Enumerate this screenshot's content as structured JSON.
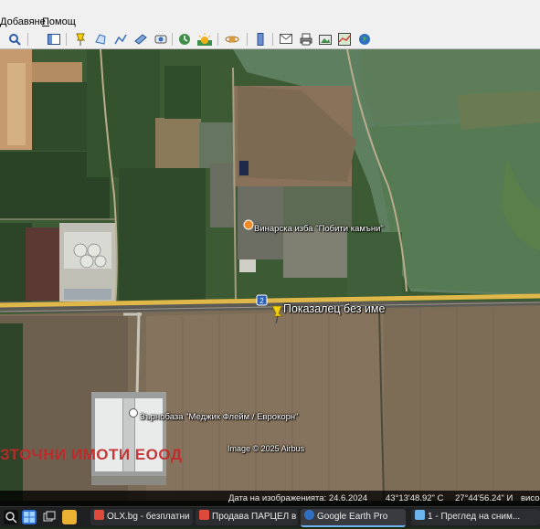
{
  "menu": {
    "item1_prefix": "Д",
    "item1_rest": "обавяне",
    "item2_prefix": "П",
    "item2_rest": "омощ"
  },
  "toolbar_icons": [
    "search-icon",
    "sidebar-icon",
    "placemark-icon",
    "polygon-icon",
    "path-icon",
    "image-overlay-icon",
    "tour-icon",
    "history-icon",
    "sun-icon",
    "planets-icon",
    "ruler-icon",
    "email-icon",
    "print-icon",
    "save-image-icon",
    "maps-icon",
    "earth-globe-icon"
  ],
  "map": {
    "label_winery": "Винарска изба \"Побити камъни\"",
    "label_placemark": "Показалец без име",
    "label_grain": "Зърнобаза \"Меджик Флейм / Еврокорн\"",
    "road_shield": "2",
    "copyright": "Image © 2025 Airbus",
    "watermark": "ЗТОЧНИ ИМОТИ ЕООД"
  },
  "status": {
    "imagery_date": "Дата на изображенията: 24.6.2024",
    "latitude": "43°13'48.92\" С",
    "longitude": "27°44'56.24\" И",
    "elevation": "висо"
  },
  "taskbar": {
    "tab_olx": "OLX.bg - безплатни ...",
    "tab_parcel": "Продава ПАРЦЕЛ в ...",
    "tab_earth": "Google Earth Pro",
    "tab_review": "1 - Преглед на сним..."
  },
  "colors": {
    "road": "#e0b84a",
    "watermark": "#c4282a",
    "placemark": "#f4d20a",
    "taskbar_accent": "#6cb4ee"
  }
}
